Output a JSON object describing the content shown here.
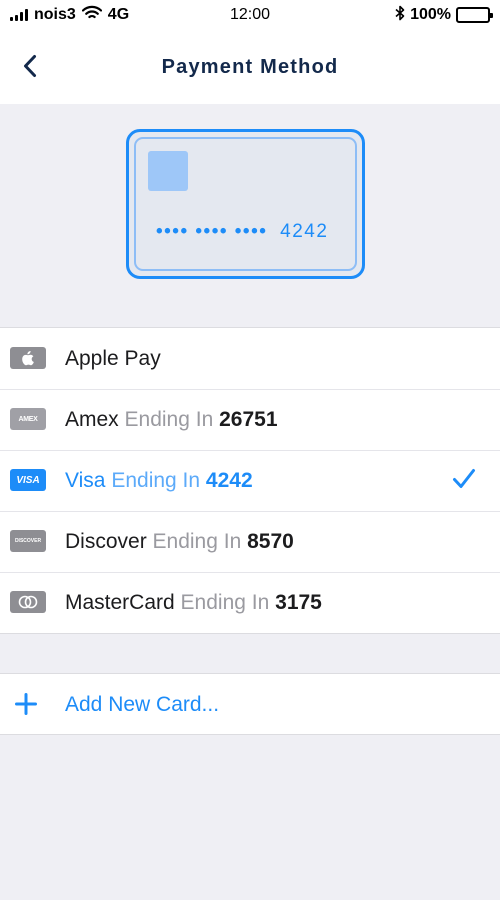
{
  "status_bar": {
    "carrier": "nois3",
    "network": "4G",
    "time": "12:00",
    "battery": "100%",
    "icons": [
      "signal-icon",
      "wifi-icon",
      "bluetooth-icon",
      "battery-icon"
    ]
  },
  "nav": {
    "title": "Payment Method",
    "back_icon": "chevron-left-icon"
  },
  "card_preview": {
    "masked_number": "•••• •••• ••••",
    "last_four": "4242"
  },
  "payment_methods": [
    {
      "brand": "Apple Pay",
      "ending_label": "",
      "last_four": "",
      "logo_text": "",
      "icon": "apple-pay-icon",
      "selected": false
    },
    {
      "brand": "Amex",
      "ending_label": "Ending In",
      "last_four": "26751",
      "logo_text": "AMEX",
      "icon": "amex-icon",
      "selected": false
    },
    {
      "brand": "Visa",
      "ending_label": "Ending In",
      "last_four": "4242",
      "logo_text": "VISA",
      "icon": "visa-icon",
      "selected": true
    },
    {
      "brand": "Discover",
      "ending_label": "Ending In",
      "last_four": "8570",
      "logo_text": "DISCOVER",
      "icon": "discover-icon",
      "selected": false
    },
    {
      "brand": "MasterCard",
      "ending_label": "Ending In",
      "last_four": "3175",
      "logo_text": "",
      "icon": "mastercard-icon",
      "selected": false
    }
  ],
  "add_card": {
    "label": "Add New Card...",
    "icon": "plus-icon"
  },
  "colors": {
    "accent": "#1d8cf8",
    "title": "#13294b",
    "muted_text": "#9a9aa0",
    "background": "#efeff4",
    "logo_gray": "#8e8e93"
  }
}
